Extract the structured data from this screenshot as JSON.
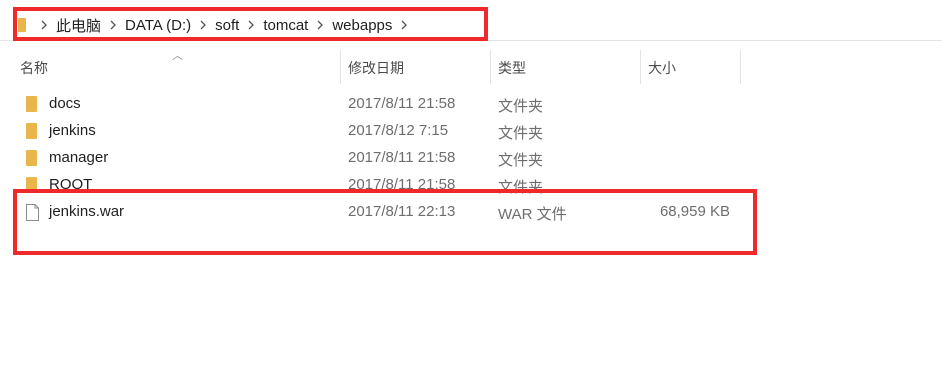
{
  "breadcrumb": [
    "此电脑",
    "DATA (D:)",
    "soft",
    "tomcat",
    "webapps"
  ],
  "columns": {
    "name": "名称",
    "modified": "修改日期",
    "type": "类型",
    "size": "大小"
  },
  "rows": [
    {
      "name": "docs",
      "modified": "2017/8/11 21:58",
      "type": "文件夹",
      "size": "",
      "icon": "folder-icon"
    },
    {
      "name": "jenkins",
      "modified": "2017/8/12 7:15",
      "type": "文件夹",
      "size": "",
      "icon": "folder-icon"
    },
    {
      "name": "manager",
      "modified": "2017/8/11 21:58",
      "type": "文件夹",
      "size": "",
      "icon": "folder-icon"
    },
    {
      "name": "ROOT",
      "modified": "2017/8/11 21:58",
      "type": "文件夹",
      "size": "",
      "icon": "folder-icon"
    },
    {
      "name": "jenkins.war",
      "modified": "2017/8/11 22:13",
      "type": "WAR 文件",
      "size": "68,959 KB",
      "icon": "file-icon"
    }
  ],
  "colors": {
    "highlight": "#ee2a2a",
    "folder": "#e8b64a"
  }
}
